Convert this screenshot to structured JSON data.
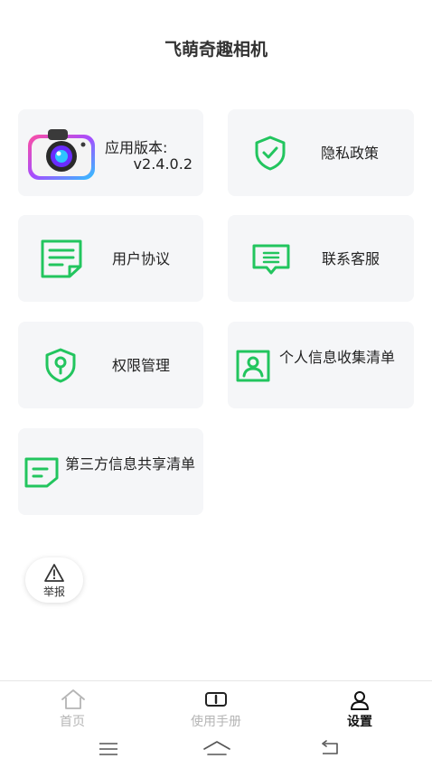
{
  "header": {
    "title": "飞萌奇趣相机"
  },
  "cards": {
    "version": {
      "label": "应用版本:",
      "value": "v2.4.0.2"
    },
    "privacy": {
      "label": "隐私政策"
    },
    "agreement": {
      "label": "用户协议"
    },
    "contact": {
      "label": "联系客服"
    },
    "permission": {
      "label": "权限管理"
    },
    "personal_info": {
      "label": "个人信息收集清单"
    },
    "third_party": {
      "label": "第三方信息共享清单"
    }
  },
  "report": {
    "label": "举报"
  },
  "tabs": [
    {
      "label": "首页",
      "icon": "home-icon"
    },
    {
      "label": "使用手册",
      "icon": "manual-icon"
    },
    {
      "label": "设置",
      "icon": "user-icon"
    }
  ],
  "colors": {
    "accent": "#22c55e",
    "card_bg": "#f5f6f8",
    "tab_inactive": "#b5b5b5"
  }
}
